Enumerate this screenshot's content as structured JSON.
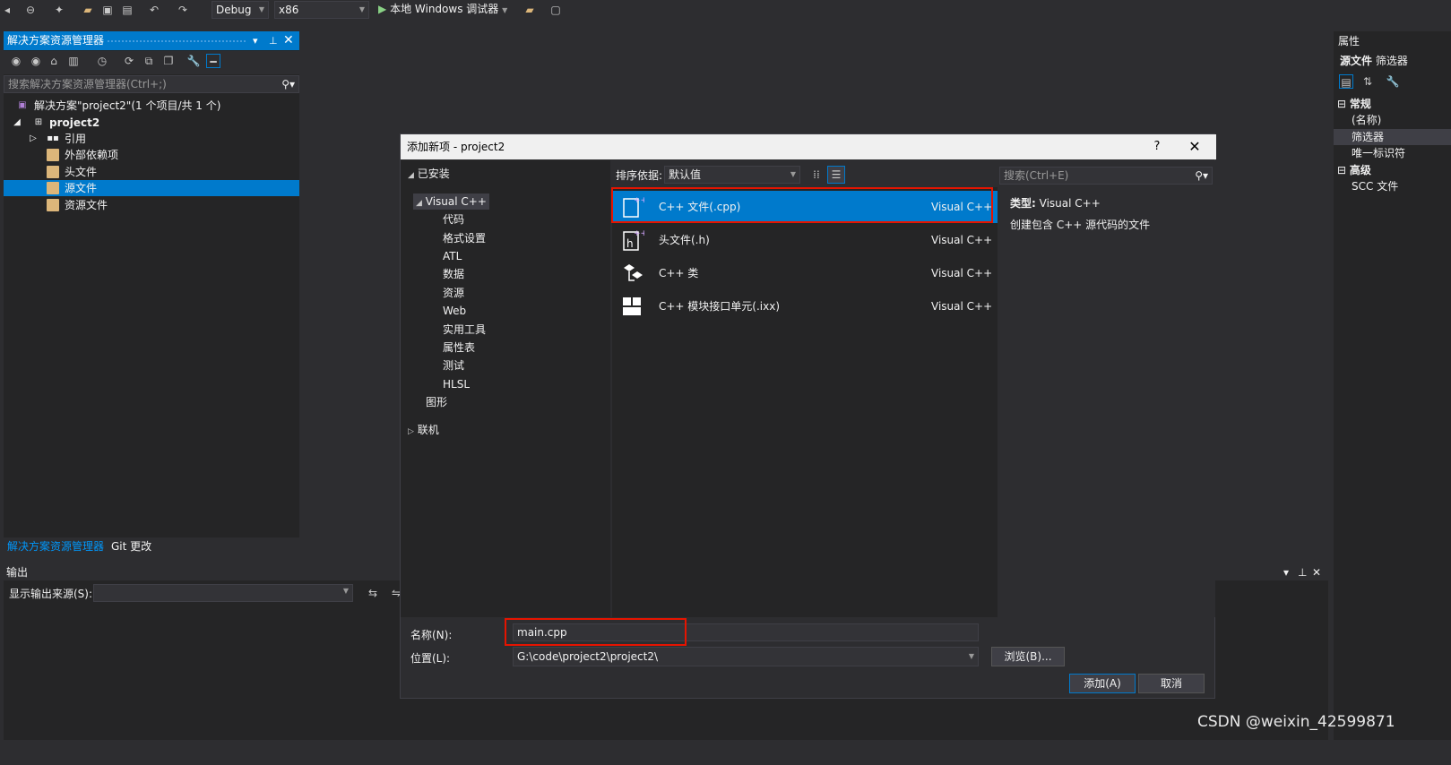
{
  "toolbar": {
    "config": "Debug",
    "platform": "x86",
    "run_label": "本地 Windows 调试器"
  },
  "solution_explorer": {
    "title": "解决方案资源管理器",
    "search_placeholder": "搜索解决方案资源管理器(Ctrl+;)",
    "tree": {
      "solution": "解决方案\"project2\"(1 个项目/共 1 个)",
      "project": "project2",
      "items": [
        "引用",
        "外部依赖项",
        "头文件",
        "源文件",
        "资源文件"
      ]
    },
    "tabs": [
      "解决方案资源管理器",
      "Git 更改"
    ]
  },
  "output": {
    "title": "输出",
    "source_label": "显示输出来源(S):"
  },
  "properties": {
    "title": "属性",
    "subject": "源文件",
    "subject_type": "筛选器",
    "section_general": "常规",
    "name_prop": "(名称)",
    "filter_prop": "筛选器",
    "guid_prop": "唯一标识符",
    "section_advanced": "高级",
    "scc_prop": "SCC 文件"
  },
  "dialog": {
    "title": "添加新项 - project2",
    "help": "?",
    "installed_label": "已安装",
    "categories": {
      "root": "Visual C++",
      "children": [
        "代码",
        "格式设置",
        "ATL",
        "数据",
        "资源",
        "Web",
        "实用工具",
        "属性表",
        "测试",
        "HLSL"
      ],
      "graphics": "图形",
      "online": "联机"
    },
    "sort_label": "排序依据:",
    "sort_value": "默认值",
    "templates": [
      {
        "name": "C++ 文件(.cpp)",
        "type": "Visual C++",
        "icon": "cpp-file-icon"
      },
      {
        "name": "头文件(.h)",
        "type": "Visual C++",
        "icon": "header-file-icon"
      },
      {
        "name": "C++ 类",
        "type": "Visual C++",
        "icon": "class-icon"
      },
      {
        "name": "C++ 模块接口单元(.ixx)",
        "type": "Visual C++",
        "icon": "module-icon"
      }
    ],
    "search_placeholder": "搜索(Ctrl+E)",
    "detail_type_label": "类型:",
    "detail_type_value": "Visual C++",
    "detail_description": "创建包含 C++ 源代码的文件",
    "name_label": "名称(N):",
    "name_value": "main.cpp",
    "location_label": "位置(L):",
    "location_value": "G:\\code\\project2\\project2\\",
    "browse_label": "浏览(B)...",
    "add_label": "添加(A)",
    "cancel_label": "取消"
  },
  "watermark": "CSDN @weixin_42599871",
  "colors": {
    "accent": "#007acc",
    "highlight_box": "#e51400",
    "background": "#2d2d30",
    "panel": "#252526"
  }
}
